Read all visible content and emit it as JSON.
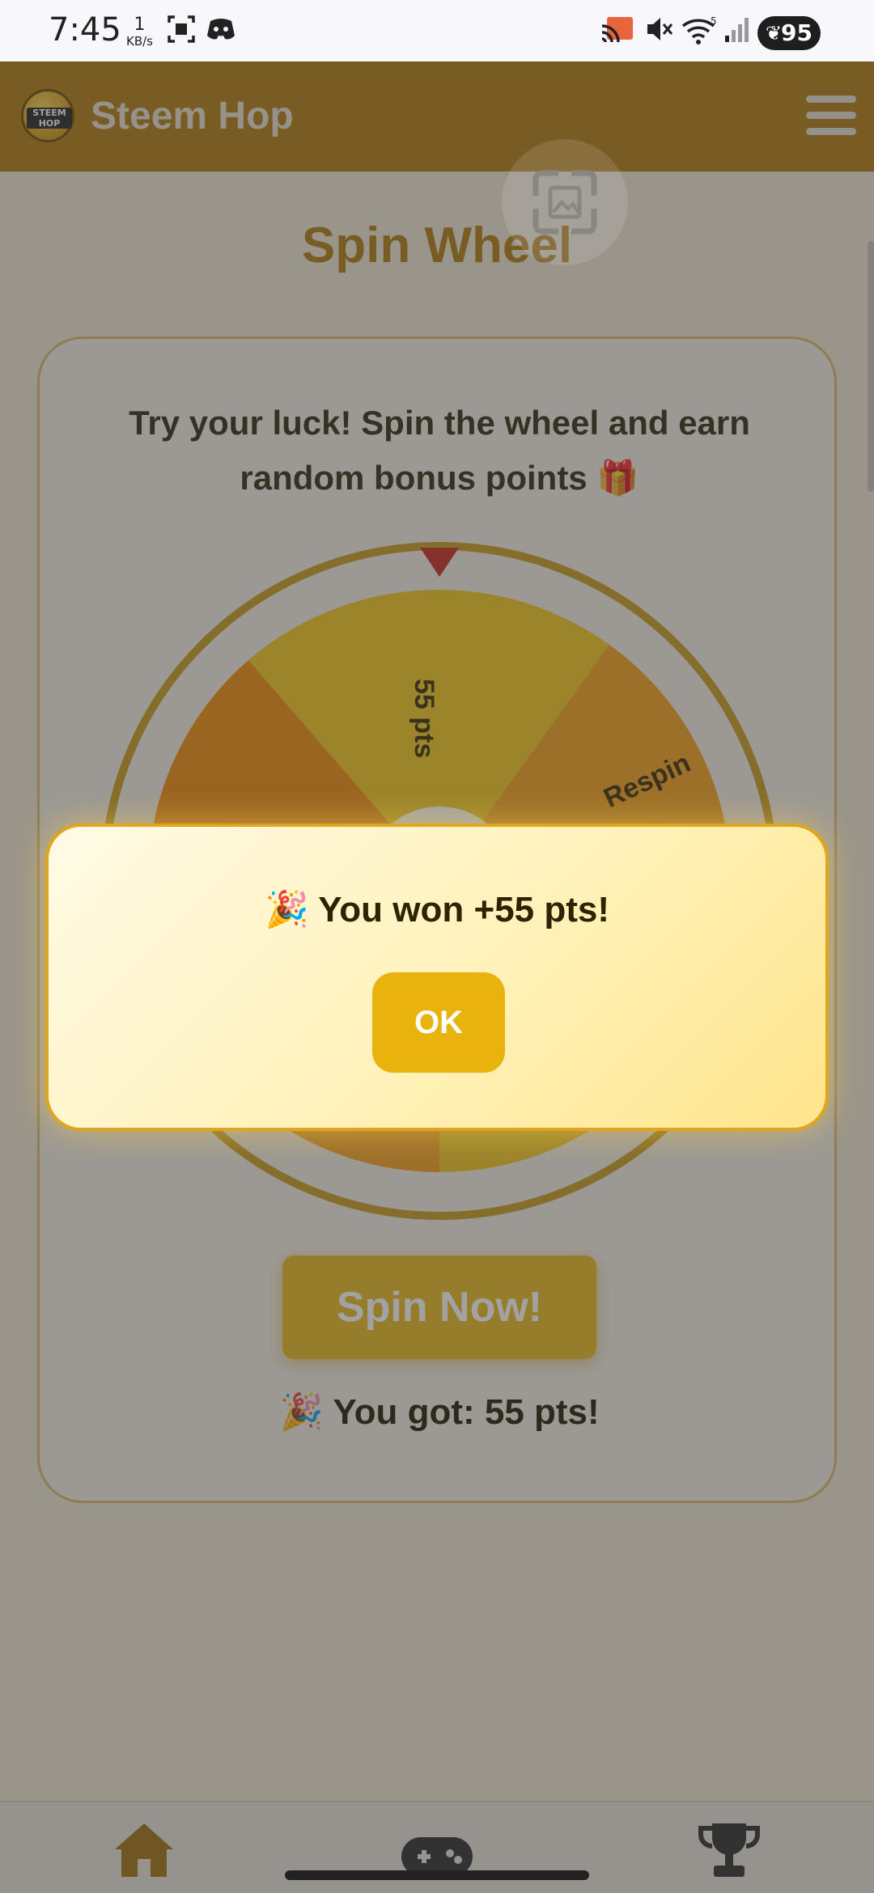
{
  "status_bar": {
    "time": "7:45",
    "net_speed_value": "1",
    "net_speed_unit": "KB/s",
    "battery": "95",
    "wifi_badge": "5"
  },
  "app": {
    "title": "Steem Hop",
    "logo_text": "STEEM HOP"
  },
  "page": {
    "title": "Spin Wheel",
    "intro_line1": "Try your luck! Spin the wheel and earn",
    "intro_line2": "random bonus points 🎁",
    "spin_button": "Spin Now!",
    "result": "🎉 You got: 55 pts!"
  },
  "wheel": {
    "visible_labels": [
      "55 pts",
      "Respin"
    ],
    "colors": {
      "rim": "#c79a1b",
      "segment_yellow": "#f3c51a",
      "segment_orange": "#f5a01a",
      "segment_dark_orange": "#ef8a08",
      "pointer": "#c8281e"
    }
  },
  "dialog": {
    "message": "🎉 You won +55 pts!",
    "ok_label": "OK"
  },
  "bottom_nav": {
    "items": [
      "home-icon",
      "gamepad-icon",
      "trophy-icon"
    ]
  },
  "theme": {
    "header_color": "#b07a0c",
    "accent": "#e8b30c"
  }
}
